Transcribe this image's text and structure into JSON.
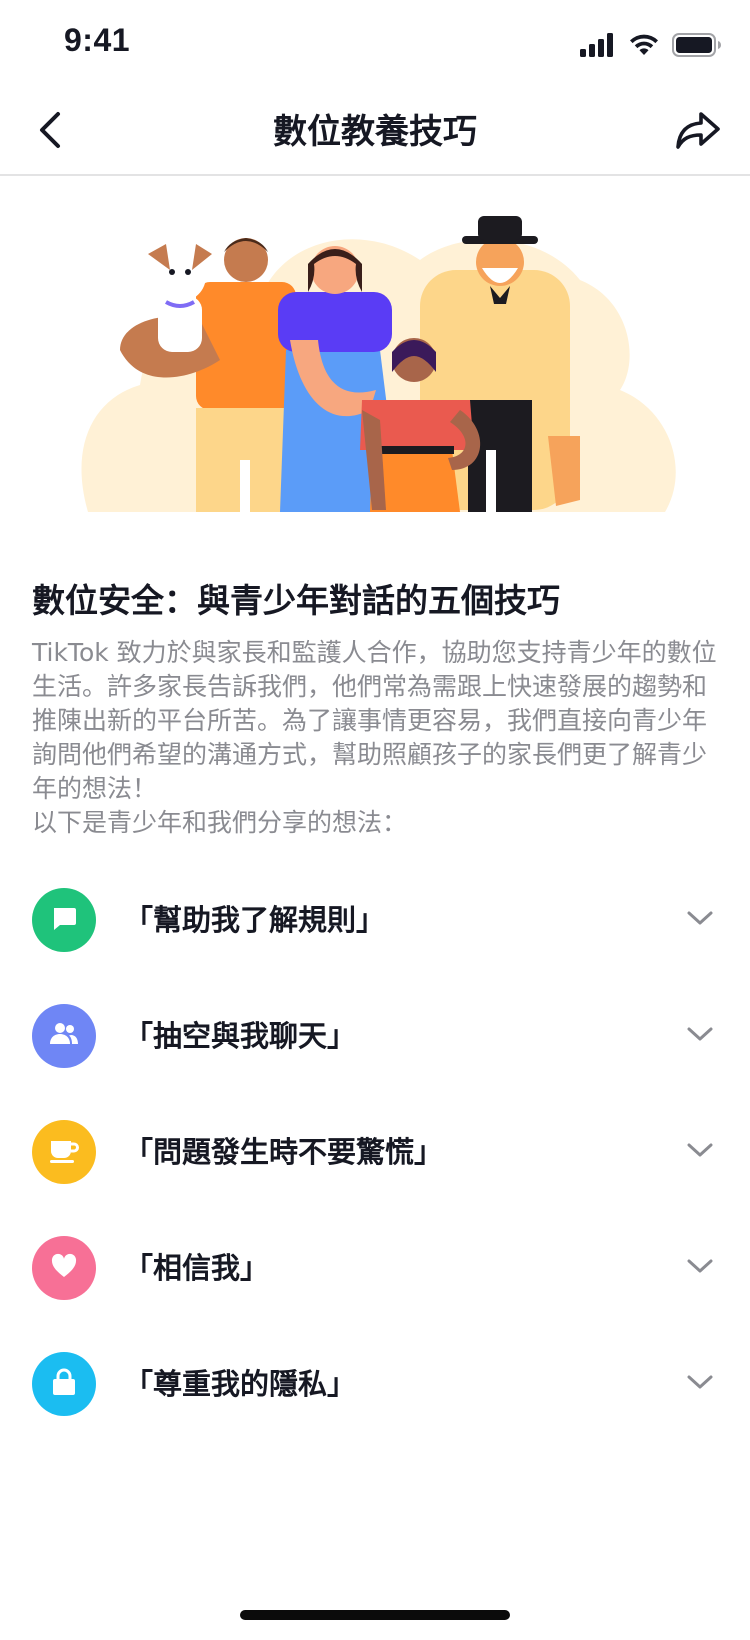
{
  "status_bar": {
    "time": "9:41",
    "icons": [
      "signal-icon",
      "wifi-icon",
      "battery-icon"
    ]
  },
  "nav": {
    "title": "數位教養技巧",
    "back_icon": "chevron-left-icon",
    "share_icon": "share-arrow-icon"
  },
  "article": {
    "title": "數位安全：與青少年對話的五個技巧",
    "paragraph": "TikTok 致力於與家長和監護人合作，協助您支持青少年的數位生活。許多家長告訴我們，他們常為需跟上快速發展的趨勢和推陳出新的平台所苦。為了讓事情更容易，我們直接向青少年詢問他們希望的溝通方式，幫助照顧孩子的家長們更了解青少年的想法！",
    "intro_line": "以下是青少年和我們分享的想法："
  },
  "tips": [
    {
      "label": "「幫助我了解規則」",
      "icon": "chat-bubble-icon",
      "color": "#1fc37b"
    },
    {
      "label": "「抽空與我聊天」",
      "icon": "people-icon",
      "color": "#6f86f5"
    },
    {
      "label": "「問題發生時不要驚慌」",
      "icon": "coffee-cup-icon",
      "color": "#fbbc1f"
    },
    {
      "label": "「相信我」",
      "icon": "heart-icon",
      "color": "#f77096"
    },
    {
      "label": "「尊重我的隱私」",
      "icon": "lock-icon",
      "color": "#1bbdf1"
    }
  ],
  "colors": {
    "text_primary": "#161823",
    "text_secondary": "#8a8b91",
    "divider": "#e3e3e4",
    "chevron": "#8a8b91"
  }
}
